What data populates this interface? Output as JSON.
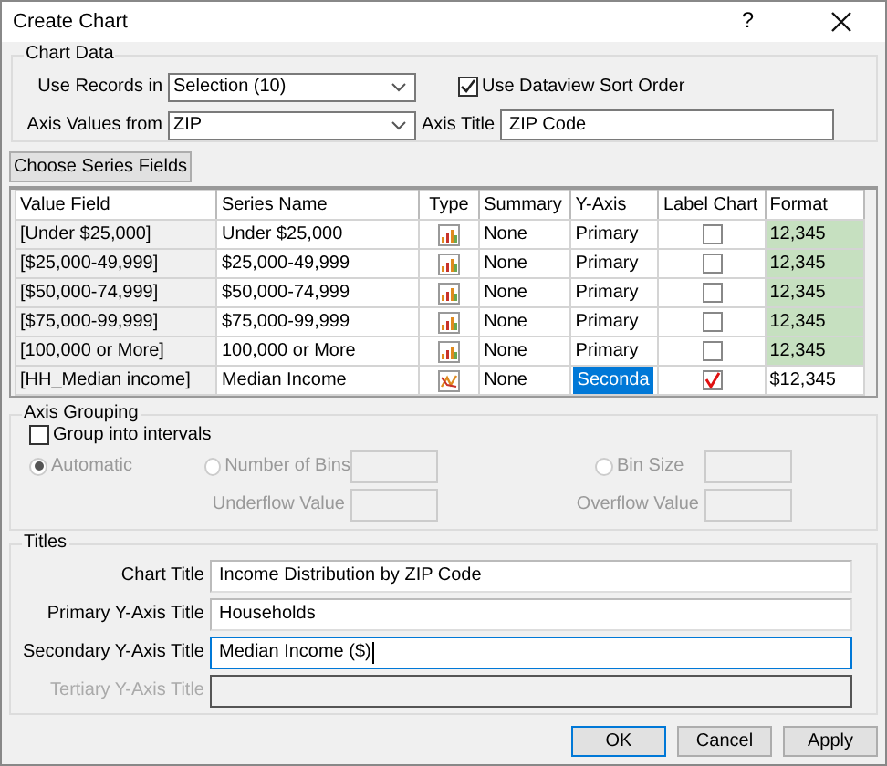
{
  "window": {
    "title": "Create Chart",
    "help": "?"
  },
  "data_source": {
    "title": "Chart Data",
    "use_records": {
      "label": "Use Records in",
      "value": "Selection (10)"
    },
    "sort_order": {
      "label": "Use Dataview Sort Order",
      "checked": true
    },
    "axis_values": {
      "label": "Axis Values from",
      "value": "ZIP"
    },
    "axis_title": {
      "label": "Axis Title",
      "value": "ZIP Code"
    }
  },
  "choose_button": "Choose Series Fields",
  "table": {
    "columns": [
      "Value Field",
      "Series Name",
      "Type",
      "Summary",
      "Y-Axis",
      "Label Chart",
      "Format"
    ],
    "rows": [
      {
        "value_field": "[Under $25,000]",
        "series_name": "Under $25,000",
        "kind": "bar",
        "summary": "None",
        "y_axis": "Primary",
        "editing": false,
        "label_chart": false,
        "format": "12,345",
        "highlighted": true
      },
      {
        "value_field": "[$25,000-49,999]",
        "series_name": "$25,000-49,999",
        "kind": "bar",
        "summary": "None",
        "y_axis": "Primary",
        "editing": false,
        "label_chart": false,
        "format": "12,345",
        "highlighted": true
      },
      {
        "value_field": "[$50,000-74,999]",
        "series_name": "$50,000-74,999",
        "kind": "bar",
        "summary": "None",
        "y_axis": "Primary",
        "editing": false,
        "label_chart": false,
        "format": "12,345",
        "highlighted": true
      },
      {
        "value_field": "[$75,000-99,999]",
        "series_name": "$75,000-99,999",
        "kind": "bar",
        "summary": "None",
        "y_axis": "Primary",
        "editing": false,
        "label_chart": false,
        "format": "12,345",
        "highlighted": true
      },
      {
        "value_field": "[100,000 or More]",
        "series_name": "100,000 or More",
        "kind": "bar",
        "summary": "None",
        "y_axis": "Primary",
        "editing": false,
        "label_chart": false,
        "format": "12,345",
        "highlighted": true
      },
      {
        "value_field": "[HH_Median income]",
        "series_name": "Median Income",
        "kind": "line",
        "summary": "None",
        "y_axis": "Seconda",
        "editing": true,
        "label_chart": true,
        "format": "$12,345",
        "highlighted": false
      }
    ]
  },
  "axis_grouping": {
    "title": "Axis Grouping",
    "disabled": true,
    "group_intervals": {
      "label": "Group into intervals",
      "checked": false
    },
    "options": [
      {
        "label": "Automatic",
        "selected": true
      },
      {
        "label": "Number of Bins",
        "selected": false
      },
      {
        "label": "Bin Size",
        "selected": false
      }
    ],
    "underflow": {
      "label": "Underflow Value"
    },
    "overflow": {
      "label": "Overflow Value"
    }
  },
  "titles": {
    "title": "Titles",
    "rows": [
      {
        "label": "Chart Title",
        "value": "Income Distribution by ZIP Code",
        "focused": false,
        "disabled": false
      },
      {
        "label": "Primary Y-Axis Title",
        "value": "Households",
        "focused": false,
        "disabled": false
      },
      {
        "label": "Secondary Y-Axis Title",
        "value": "Median Income ($)",
        "focused": true,
        "disabled": false
      },
      {
        "label": "Tertiary Y-Axis Title",
        "value": "",
        "focused": false,
        "disabled": true
      }
    ]
  },
  "buttons": [
    {
      "label": "OK",
      "default": true
    },
    {
      "label": "Cancel",
      "default": false
    },
    {
      "label": "Apply",
      "default": false
    }
  ]
}
